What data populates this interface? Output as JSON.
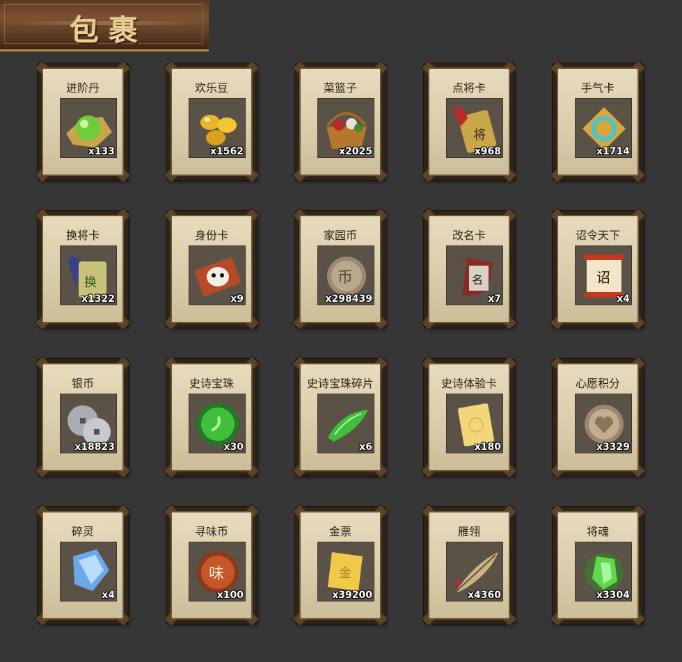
{
  "header": {
    "title": "包裹"
  },
  "items": [
    {
      "name": "进阶丹",
      "count": "x133",
      "icon": "jade-orb-icon"
    },
    {
      "name": "欢乐豆",
      "count": "x1562",
      "icon": "gold-beans-icon"
    },
    {
      "name": "菜篮子",
      "count": "x2025",
      "icon": "flower-basket-icon"
    },
    {
      "name": "点将卡",
      "count": "x968",
      "icon": "general-card-icon"
    },
    {
      "name": "手气卡",
      "count": "x1714",
      "icon": "luck-card-icon"
    },
    {
      "name": "换将卡",
      "count": "x1322",
      "icon": "swap-card-icon"
    },
    {
      "name": "身份卡",
      "count": "x9",
      "icon": "mask-card-icon"
    },
    {
      "name": "家园币",
      "count": "x298439",
      "icon": "home-coin-icon"
    },
    {
      "name": "改名卡",
      "count": "x7",
      "icon": "rename-card-icon"
    },
    {
      "name": "诏令天下",
      "count": "x4",
      "icon": "edict-scroll-icon"
    },
    {
      "name": "银币",
      "count": "x18823",
      "icon": "silver-coins-icon"
    },
    {
      "name": "史诗宝珠",
      "count": "x30",
      "icon": "epic-orb-icon"
    },
    {
      "name": "史诗宝珠碎片",
      "count": "x6",
      "icon": "orb-shard-icon"
    },
    {
      "name": "史诗体验卡",
      "count": "x180",
      "icon": "trial-card-icon"
    },
    {
      "name": "心愿积分",
      "count": "x3329",
      "icon": "wish-coin-icon"
    },
    {
      "name": "碎灵",
      "count": "x4",
      "icon": "spirit-crystal-icon"
    },
    {
      "name": "寻味币",
      "count": "x100",
      "icon": "flavor-coin-icon"
    },
    {
      "name": "金票",
      "count": "x39200",
      "icon": "gold-ticket-icon"
    },
    {
      "name": "雁翎",
      "count": "x4360",
      "icon": "feather-icon"
    },
    {
      "name": "将魂",
      "count": "x3304",
      "icon": "soul-gem-icon"
    }
  ],
  "colors": {
    "background": "#363636",
    "card_paper": "#ded2b1",
    "card_frame": "#2e2418",
    "banner": "#6b4529",
    "banner_text": "#e9cf98",
    "count_text": "#ffffff"
  }
}
